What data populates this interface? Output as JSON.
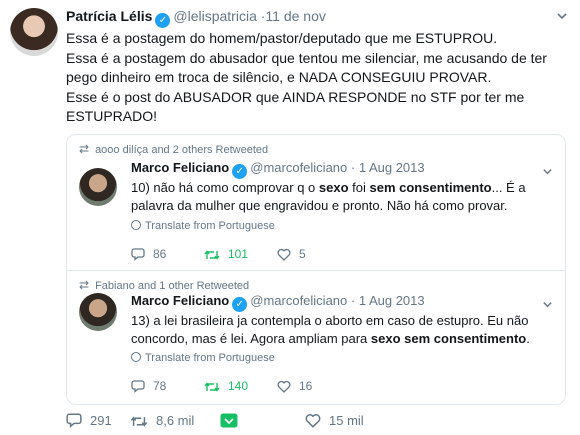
{
  "tweet": {
    "name": "Patrícia Lélis",
    "handle": "@lelispatricia",
    "time": "·11 de nov",
    "lines": [
      "Essa é a postagem do homem/pastor/deputado que me ESTUPROU.",
      "Essa é a postagem do abusador que tentou me silenciar, me acusando de ter pego dinheiro em troca de silêncio, e NADA CONSEGUIU PROVAR.",
      "Esse é o post do ABUSADOR que AINDA RESPONDE no STF por ter me ESTUPRADO!"
    ],
    "replies": "291",
    "retweets": "8,6 mil",
    "likes": "15 mil"
  },
  "quoted_1": {
    "context": "aooo dilíça and 2 others Retweeted",
    "name": "Marco Feliciano",
    "handle": "@marcofeliciano",
    "time": "· 1 Aug 2013",
    "text_a": "10) não há como comprovar q o ",
    "bold_a": "sexo",
    "text_b": " foi ",
    "bold_b": "sem consentimento",
    "text_c": "... É a palavra da mulher que engravidou e pronto. Não há como provar.",
    "translate": "Translate from Portuguese",
    "replies": "86",
    "retweets": "101",
    "likes": "5"
  },
  "quoted_2": {
    "context": "Fabiano and 1 other Retweeted",
    "name": "Marco Feliciano",
    "handle": "@marcofeliciano",
    "time": "· 1 Aug 2013",
    "text_a": "13) a lei brasileira ja contempla o aborto em caso de estupro. Eu não concordo, mas é lei. Agora ampliam para ",
    "bold_a": "sexo sem consentimento",
    "text_b": ".",
    "translate": "Translate from Portuguese",
    "replies": "78",
    "retweets": "140",
    "likes": "16"
  },
  "colors": {
    "accent": "#1da1f2",
    "muted": "#657786",
    "retweet_green": "#17bf63",
    "border": "#e1e8ed"
  },
  "icons": [
    "verified-icon",
    "caret-down-icon",
    "retweet-icon",
    "reply-icon",
    "like-icon",
    "dm-icon",
    "globe-icon"
  ]
}
